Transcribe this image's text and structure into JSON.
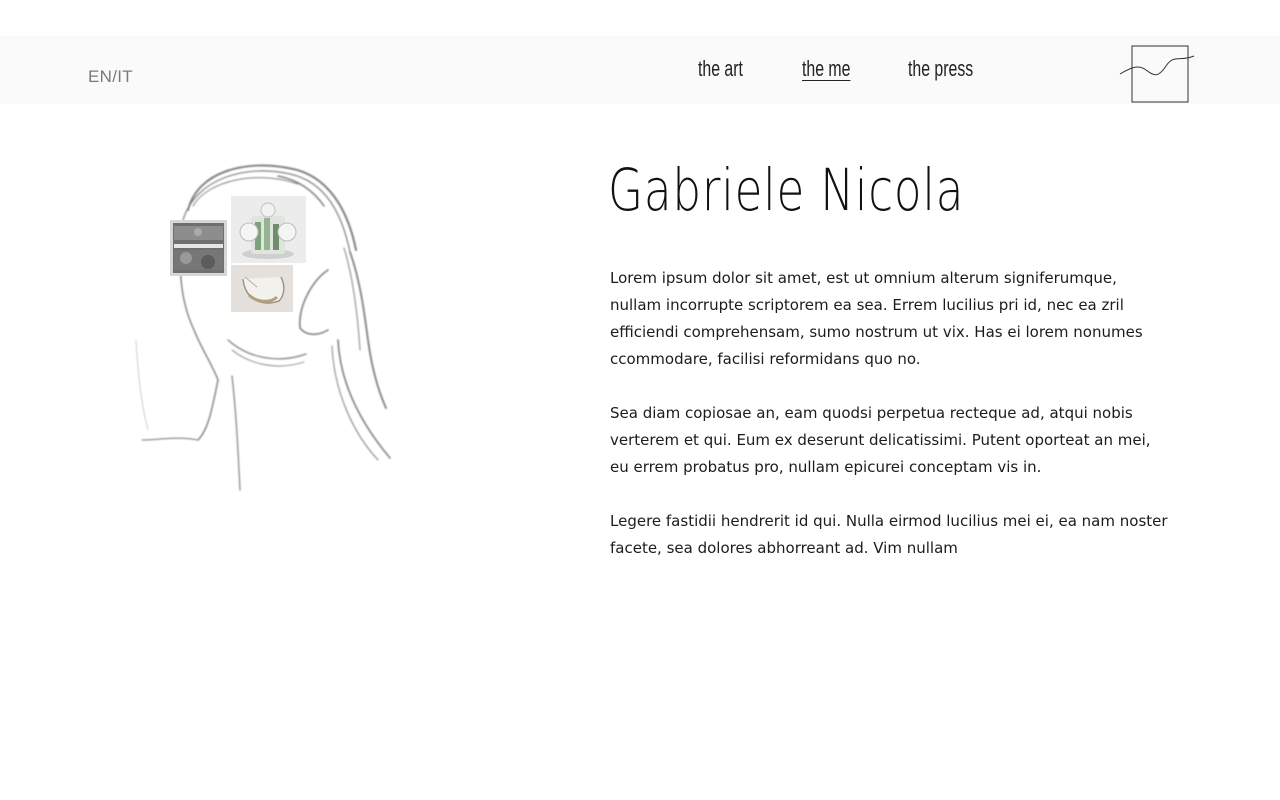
{
  "header": {
    "language_toggle": "EN/IT",
    "nav": [
      {
        "label": "the art",
        "active": false
      },
      {
        "label": "the me",
        "active": true
      },
      {
        "label": "the press",
        "active": false
      }
    ],
    "logo_icon": "framed-wave-logo-icon"
  },
  "profile": {
    "name": "Gabriele Nicola",
    "bio": [
      "Lorem ipsum dolor sit amet, est ut omnium alterum signiferumque, nullam incorrupte scriptorem ea sea. Errem lucilius pri id, nec ea zril efficiendi comprehensam, sumo nostrum ut vix. Has ei lorem nonumes ccommodare, facilisi reformidans quo no.",
      "Sea diam copiosae an, eam quodsi perpetua recteque ad, atqui nobis verterem et qui. Eum ex deserunt delicatissimi. Putent oporteat an mei, eu errem probatus pro, nullam epicurei conceptam vis in.",
      "Legere fastidii hendrerit id qui. Nulla eirmod lucilius mei ei, ea nam noster facete, sea dolores abhorreant ad. Vim nullam"
    ]
  },
  "portrait": {
    "icon": "sketched-head-drawing",
    "thumbnails": [
      "artwork-thumbnail-1",
      "artwork-thumbnail-2",
      "artwork-thumbnail-3"
    ]
  },
  "colors": {
    "header_bg": "#fafafa",
    "text": "#111111",
    "muted": "#7a7a7a"
  }
}
